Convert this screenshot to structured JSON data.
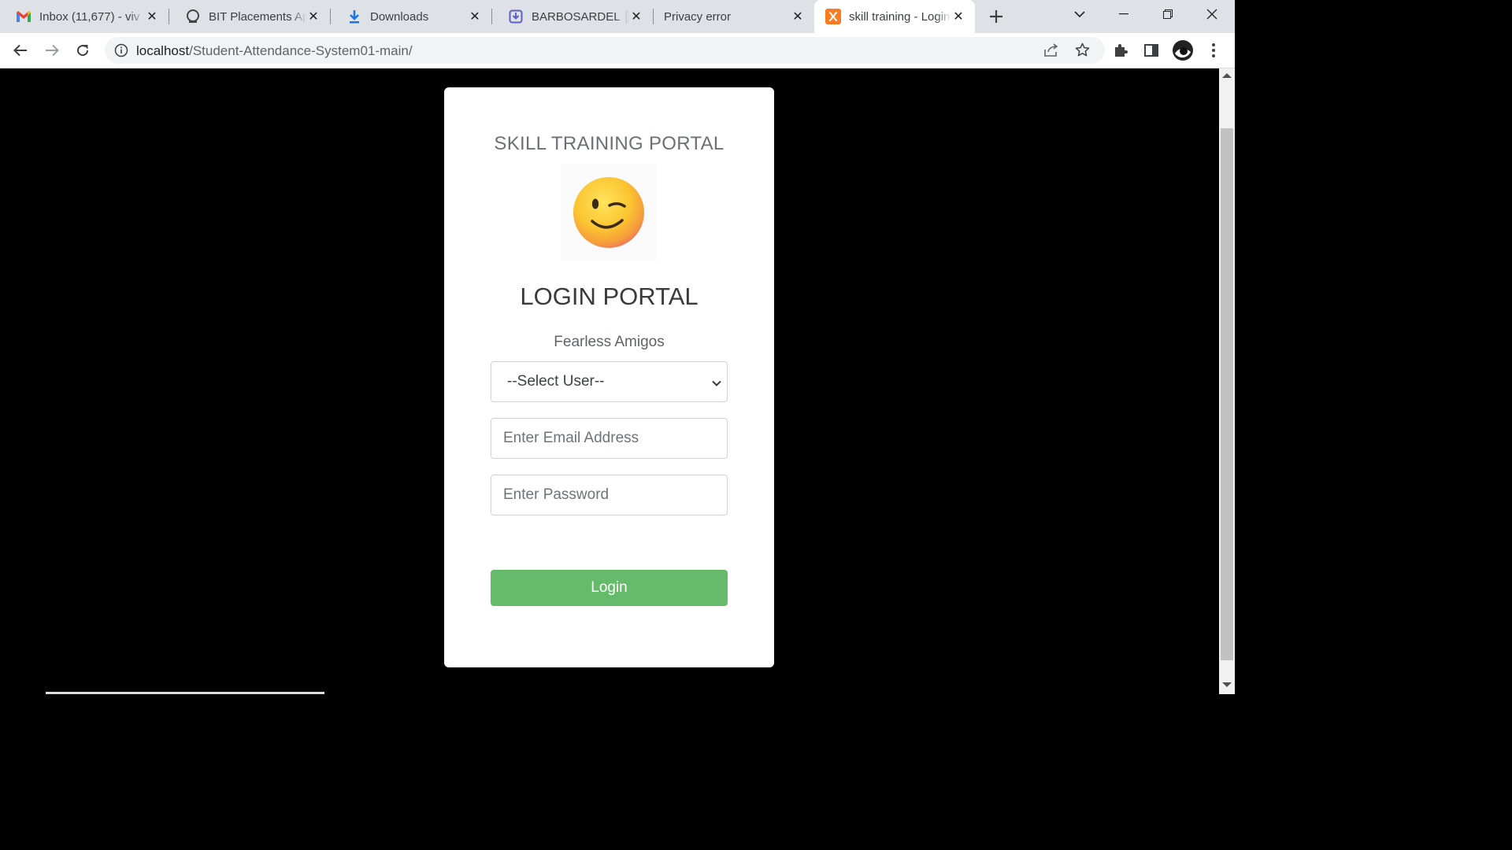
{
  "browser": {
    "tabs": [
      {
        "title": "Inbox (11,677) - viv",
        "icon": "gmail-icon",
        "active": false
      },
      {
        "title": "BIT Placements App",
        "icon": "placements-icon",
        "active": false
      },
      {
        "title": "Downloads",
        "icon": "download-icon",
        "active": false
      },
      {
        "title": "BARBOSARDEL ╟ro",
        "icon": "download-page-icon",
        "active": false
      },
      {
        "title": "Privacy error",
        "icon": "",
        "active": false
      },
      {
        "title": "skill training - Login",
        "icon": "xampp-icon",
        "active": true
      }
    ],
    "url_host": "localhost",
    "url_path": "/Student-Attendance-System01-main/",
    "accent_color": "#1a73e8"
  },
  "page": {
    "portal_title": "SKILL TRAINING PORTAL",
    "emoji": "winking-face",
    "login_title": "LOGIN PORTAL",
    "team_name": "Fearless Amigos",
    "select_user_value": "--Select User--",
    "email_placeholder": "Enter Email Address",
    "password_placeholder": "Enter Password",
    "login_label": "Login",
    "button_color": "#66bb6a"
  }
}
